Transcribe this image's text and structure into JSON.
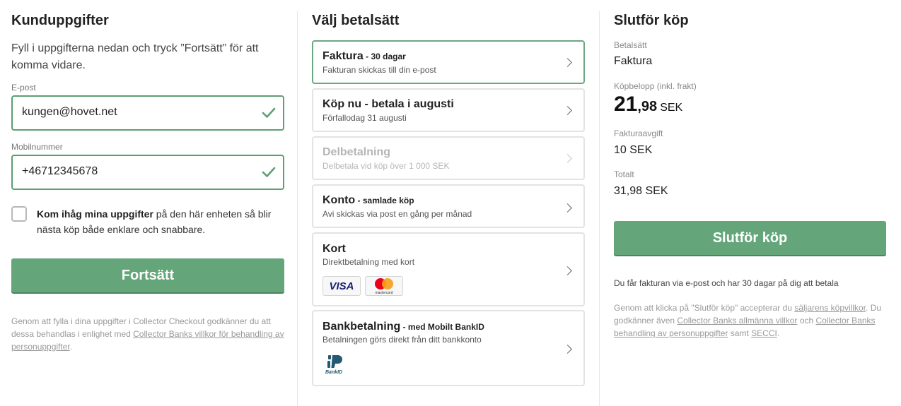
{
  "customer": {
    "title": "Kunduppgifter",
    "intro": "Fyll i uppgifterna nedan och tryck ”Fortsätt” för att komma vidare.",
    "email_label": "E-post",
    "email_value": "kungen@hovet.net",
    "phone_label": "Mobilnummer",
    "phone_value": "+46712345678",
    "remember_bold": "Kom ihåg mina uppgifter",
    "remember_rest": " på den här enheten så blir nästa köp både enklare och snabbare.",
    "continue_label": "Fortsätt",
    "legal_prefix": "Genom att fylla i dina uppgifter i Collector Checkout godkänner du att dessa behandlas i enlighet med ",
    "legal_link": "Collector Banks villkor för behandling av personuppgifter",
    "legal_suffix": "."
  },
  "payment": {
    "title": "Välj betalsätt",
    "methods": [
      {
        "title": "Faktura",
        "title_extra": " - 30 dagar",
        "subtitle": "Fakturan skickas till din e-post"
      },
      {
        "title": "Köp nu - betala i augusti",
        "title_extra": "",
        "subtitle": "Förfallodag 31 augusti"
      },
      {
        "title": "Delbetalning",
        "title_extra": "",
        "subtitle": "Delbetala vid köp över 1 000 SEK"
      },
      {
        "title": "Konto",
        "title_extra": " - samlade köp",
        "subtitle": "Avi skickas via post en gång per månad"
      },
      {
        "title": "Kort",
        "title_extra": "",
        "subtitle": "Direktbetalning med kort"
      },
      {
        "title": "Bankbetalning",
        "title_extra": " - med Mobilt BankID",
        "subtitle": "Betalningen görs direkt från ditt bankkonto"
      }
    ],
    "visa_text": "VISA",
    "mastercard_text": "mastercard",
    "bankid_text": "BankID"
  },
  "summary": {
    "title": "Slutför köp",
    "method_label": "Betalsätt",
    "method_value": "Faktura",
    "amount_label": "Köpbelopp (inkl. frakt)",
    "amount_int": "21",
    "amount_dec": ",98",
    "amount_currency": "SEK",
    "fee_label": "Fakturaavgift",
    "fee_value": "10 SEK",
    "total_label": "Totalt",
    "total_value": "31,98 SEK",
    "complete_label": "Slutför köp",
    "notice": "Du får fakturan via e-post och har 30 dagar på dig att betala",
    "terms_1": "Genom att klicka på \"Slutför köp\" accepterar du ",
    "terms_link_1": "säljarens köpvillkor",
    "terms_2": ". Du godkänner även ",
    "terms_link_2": "Collector Banks allmänna villkor",
    "terms_3": " och ",
    "terms_link_3": "Collector Banks behandling av personuppgifter",
    "terms_4": " samt ",
    "terms_link_4": "SECCI",
    "terms_5": "."
  },
  "colors": {
    "accent": "#64a67a",
    "valid": "#5d9e72",
    "selected_border": "#6aa880"
  }
}
